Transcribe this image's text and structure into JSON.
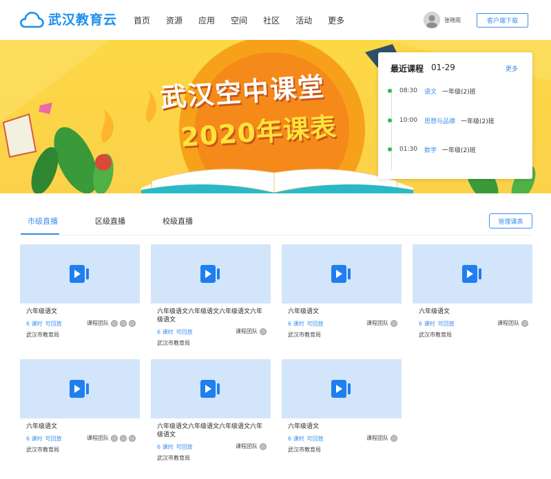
{
  "header": {
    "logo_text": "武汉教育云",
    "nav": [
      "首页",
      "资源",
      "应用",
      "空间",
      "社区",
      "活动",
      "更多"
    ],
    "user_name": "张晓雨",
    "download_label": "客户端下载"
  },
  "banner": {
    "title": "武汉空中课堂",
    "subtitle": "2020年课表"
  },
  "recent": {
    "title": "最近课程",
    "date": "01-29",
    "more_label": "更多",
    "lessons": [
      {
        "time": "08:30",
        "subject": "语文",
        "class": "一年级(2)班"
      },
      {
        "time": "10:00",
        "subject": "思想与品德",
        "class": "一年级(2)班"
      },
      {
        "time": "01:30",
        "subject": "数学",
        "class": "一年级(2)班"
      }
    ]
  },
  "tabs": {
    "items": [
      "市级直播",
      "区级直播",
      "校级直播"
    ],
    "active_index": 0,
    "manage_label": "管理课表"
  },
  "cards": [
    {
      "title": "六年级语文",
      "lessons": "6 课时",
      "replay": "可回放",
      "team": "课程团队",
      "members": 3,
      "org": "武汉市教育局"
    },
    {
      "title": "六年级语文六年级语文六年级语文六年级语文",
      "lessons": "6 课时",
      "replay": "可回放",
      "team": "课程团队",
      "members": 1,
      "org": "武汉市教育局"
    },
    {
      "title": "六年级语文",
      "lessons": "6 课时",
      "replay": "可回放",
      "team": "课程团队",
      "members": 1,
      "org": "武汉市教育局"
    },
    {
      "title": "六年级语文",
      "lessons": "6 课时",
      "replay": "可回放",
      "team": "课程团队",
      "members": 1,
      "org": "武汉市教育局"
    },
    {
      "title": "六年级语文",
      "lessons": "6 课时",
      "replay": "可回放",
      "team": "课程团队",
      "members": 3,
      "org": "武汉市教育局"
    },
    {
      "title": "六年级语文六年级语文六年级语文六年级语文",
      "lessons": "6 课时",
      "replay": "可回放",
      "team": "课程团队",
      "members": 1,
      "org": "武汉市教育局"
    },
    {
      "title": "六年级语文",
      "lessons": "6 课时",
      "replay": "可回放",
      "team": "课程团队",
      "members": 1,
      "org": "武汉市教育局"
    }
  ],
  "colors": {
    "accent": "#3a8ef0",
    "dot": "#27c04a",
    "thumb": "#d3e5fa",
    "banner": "#fcd845"
  }
}
